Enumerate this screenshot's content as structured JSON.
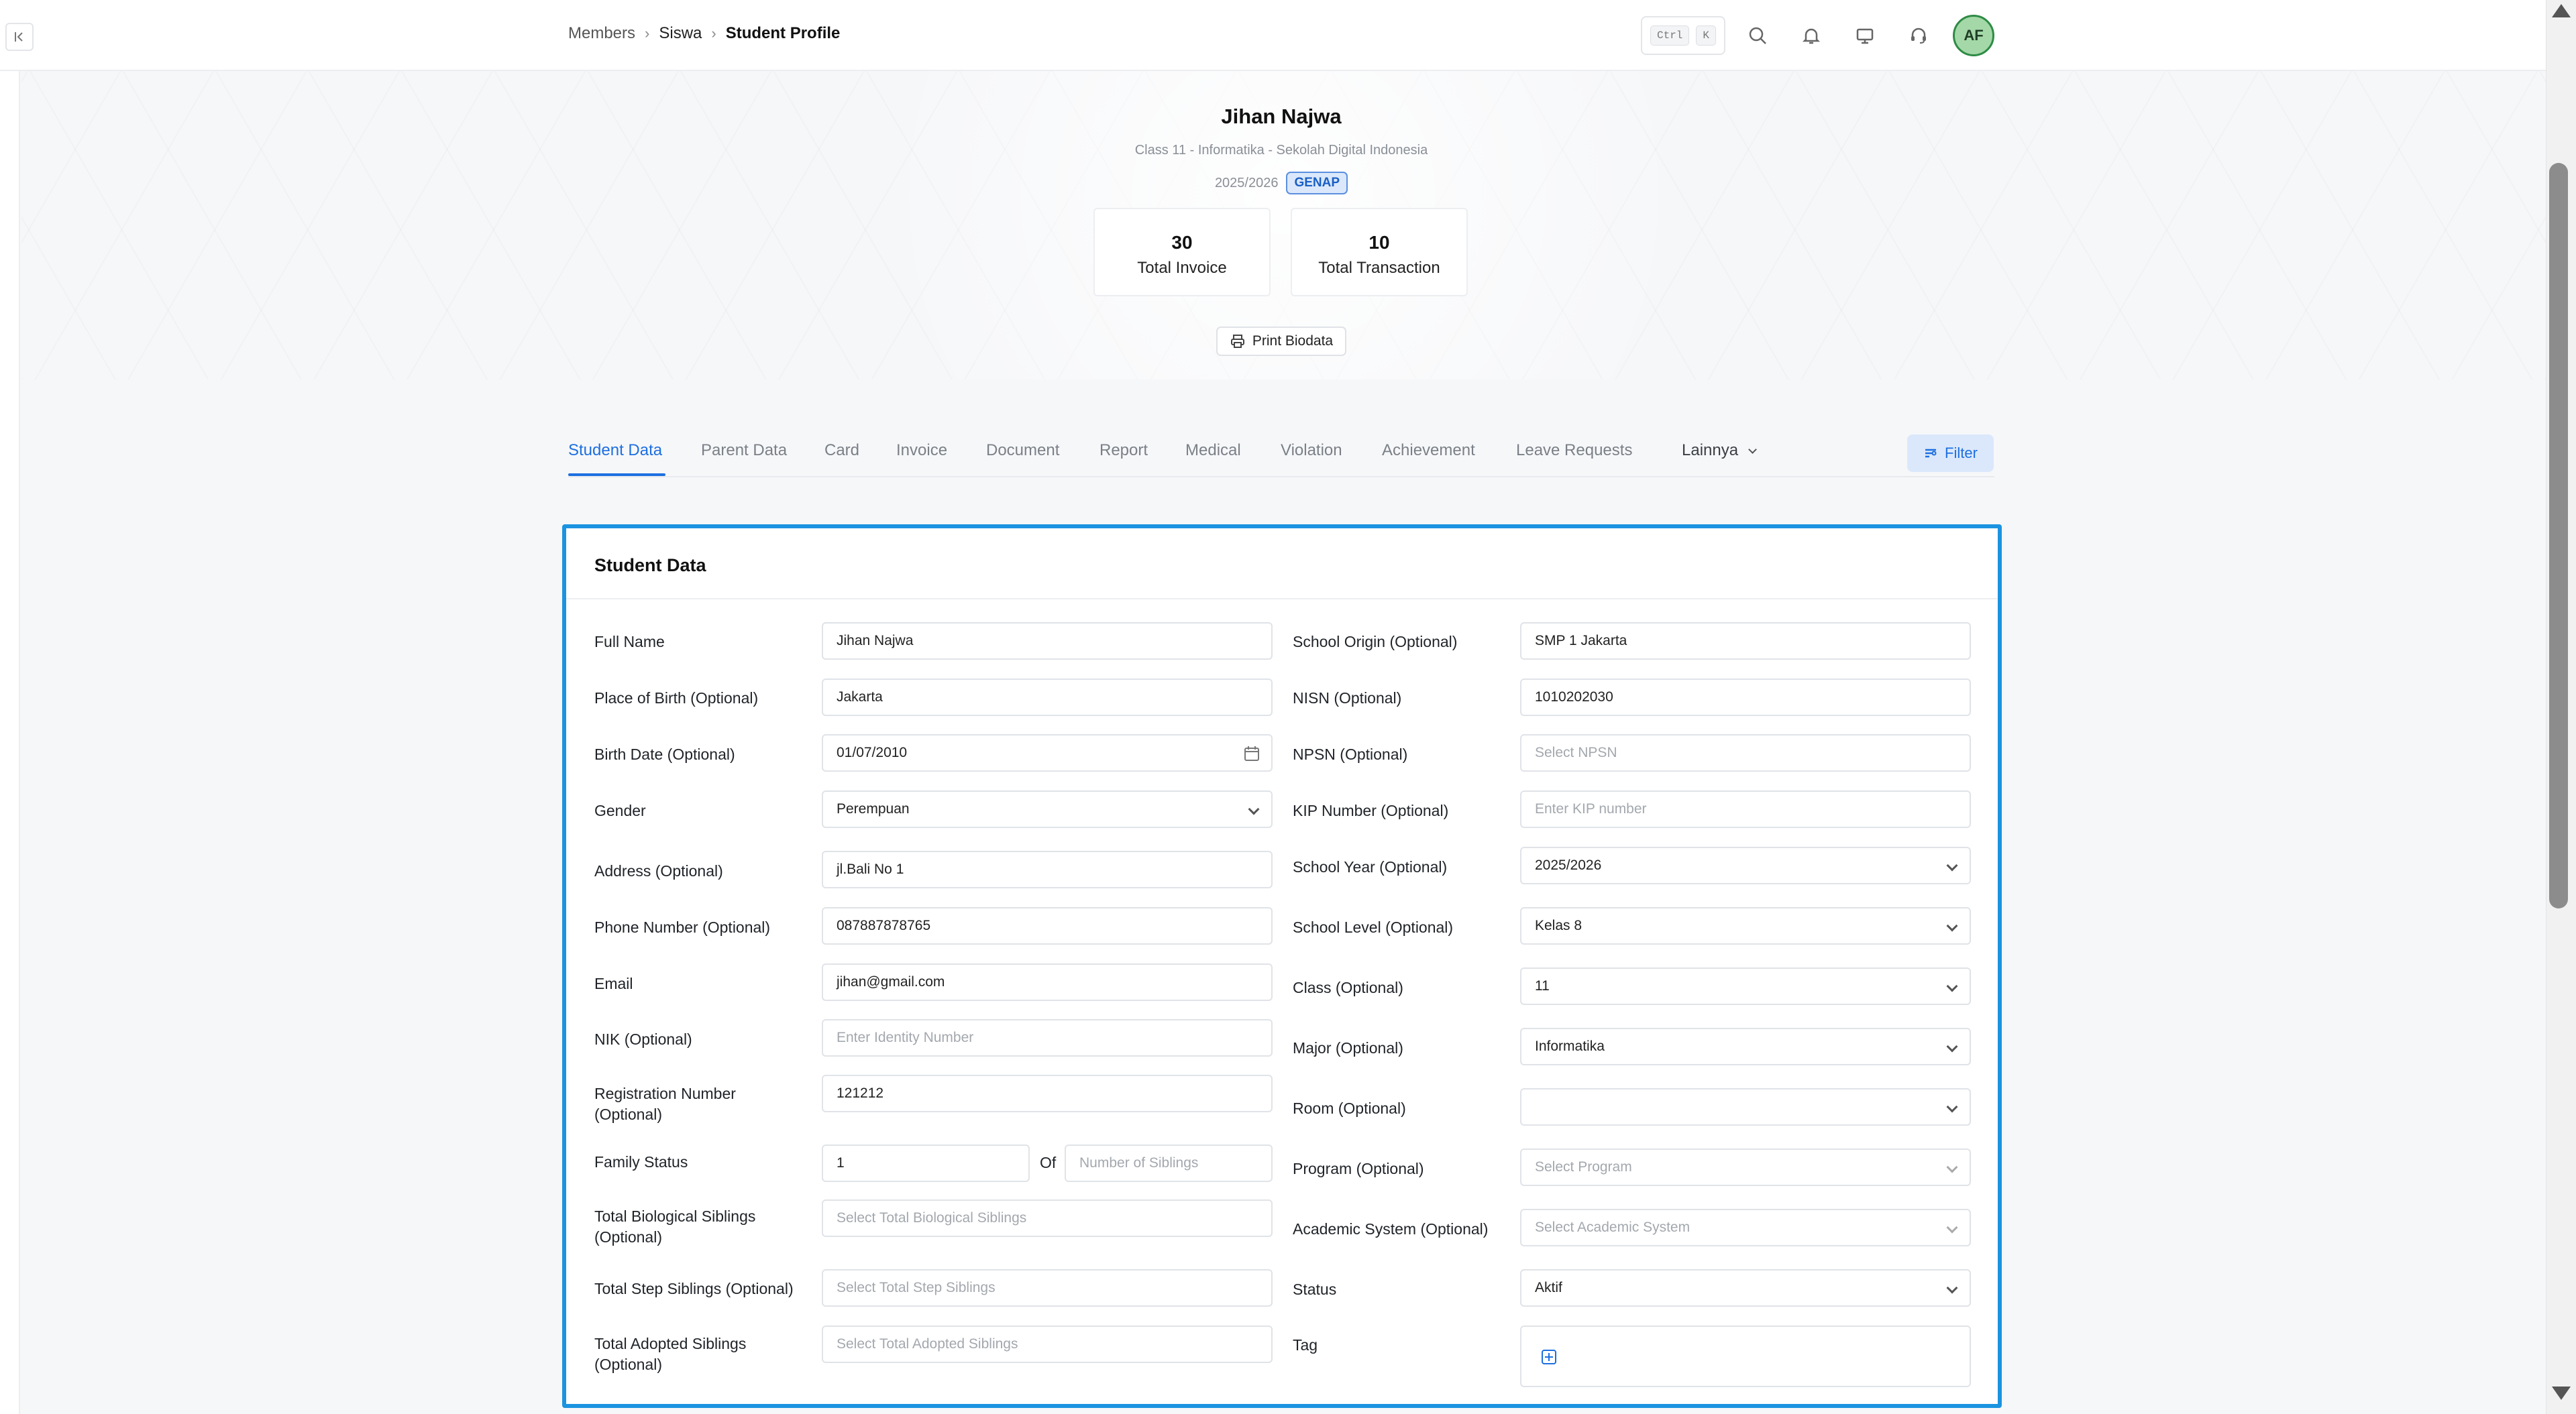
{
  "topbar": {
    "breadcrumb": [
      "Members",
      "Siswa",
      "Student Profile"
    ],
    "shortcut_keys": [
      "Ctrl",
      "K"
    ],
    "avatar_initials": "AF",
    "icons": [
      "collapse-sidebar-icon",
      "search-icon",
      "bell-icon",
      "monitor-icon",
      "support-icon"
    ]
  },
  "profile": {
    "name": "Jihan Najwa",
    "subtitle": "Class 11 - Informatika - Sekolah Digital Indonesia",
    "year": "2025/2026",
    "semester_badge": "GENAP",
    "stats": [
      {
        "value": "30",
        "label": "Total Invoice"
      },
      {
        "value": "10",
        "label": "Total Transaction"
      }
    ],
    "print_label": "Print Biodata"
  },
  "tabs": {
    "items": [
      "Student Data",
      "Parent Data",
      "Card",
      "Invoice",
      "Document",
      "Report",
      "Medical",
      "Violation",
      "Achievement",
      "Leave Requests",
      "Lainnya"
    ],
    "active": "Student Data",
    "filter_label": "Filter"
  },
  "form": {
    "title": "Student Data",
    "left": {
      "full_name": {
        "label": "Full Name",
        "value": "Jihan Najwa"
      },
      "place_of_birth": {
        "label": "Place of Birth (Optional)",
        "value": "Jakarta"
      },
      "birth_date": {
        "label": "Birth Date (Optional)",
        "value": "01/07/2010"
      },
      "gender": {
        "label": "Gender",
        "value": "Perempuan"
      },
      "address": {
        "label": "Address (Optional)",
        "value": "jl.Bali No 1"
      },
      "phone": {
        "label": "Phone Number (Optional)",
        "value": "087887878765"
      },
      "email": {
        "label": "Email",
        "value": "jihan@gmail.com"
      },
      "nik": {
        "label": "NIK (Optional)",
        "placeholder": "Enter Identity Number"
      },
      "registration": {
        "label_line1": "Registration Number",
        "label_line2": "(Optional)",
        "value": "121212"
      },
      "family_status": {
        "label": "Family Status",
        "value": "1",
        "of": "Of",
        "siblings_placeholder": "Number of Siblings"
      },
      "bio_siblings": {
        "label_line1": "Total Biological Siblings",
        "label_line2": "(Optional)",
        "placeholder": "Select Total Biological Siblings"
      },
      "step_siblings": {
        "label": "Total Step Siblings (Optional)",
        "placeholder": "Select Total Step Siblings"
      },
      "adopted_siblings": {
        "label_line1": "Total Adopted Siblings",
        "label_line2": "(Optional)",
        "placeholder": "Select Total Adopted Siblings"
      }
    },
    "right": {
      "school_origin": {
        "label": "School Origin (Optional)",
        "value": "SMP 1 Jakarta"
      },
      "nisn": {
        "label": "NISN (Optional)",
        "value": "1010202030"
      },
      "npsn": {
        "label": "NPSN (Optional)",
        "placeholder": "Select NPSN"
      },
      "kip": {
        "label": "KIP Number (Optional)",
        "placeholder": "Enter KIP number"
      },
      "school_year": {
        "label": "School Year (Optional)",
        "value": "2025/2026"
      },
      "school_level": {
        "label": "School Level (Optional)",
        "value": "Kelas 8"
      },
      "class": {
        "label": "Class (Optional)",
        "value": "11"
      },
      "major": {
        "label": "Major (Optional)",
        "value": "Informatika"
      },
      "room": {
        "label": "Room (Optional)",
        "value": ""
      },
      "program": {
        "label": "Program (Optional)",
        "placeholder": "Select Program"
      },
      "academic_system": {
        "label": "Academic System (Optional)",
        "placeholder": "Select Academic System"
      },
      "status": {
        "label": "Status",
        "value": "Aktif"
      },
      "tag": {
        "label": "Tag"
      }
    }
  },
  "colors": {
    "accent": "#1d6fe0",
    "highlight_border": "#1b93e0",
    "badge_bg": "#dbe8fb"
  }
}
